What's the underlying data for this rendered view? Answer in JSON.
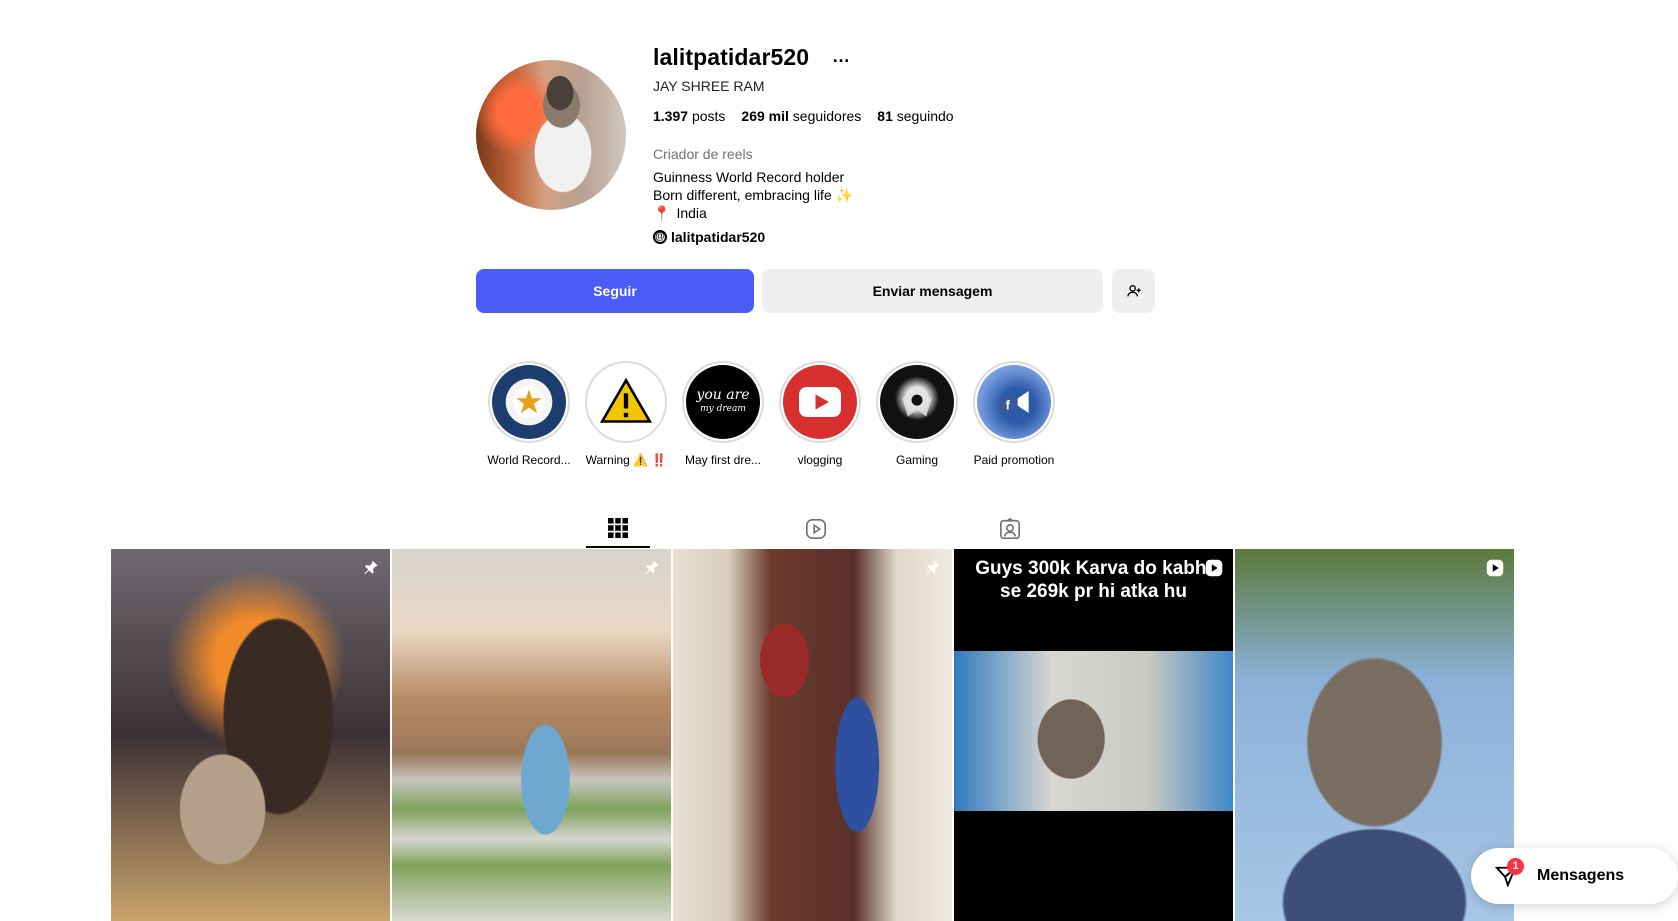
{
  "profile": {
    "username": "lalitpatidar520",
    "more_icon": "…",
    "full_name": "JAY SHREE RAM",
    "stats": {
      "posts_value": "1.397",
      "posts_label": "posts",
      "followers_value": "269 mil",
      "followers_label": "seguidores",
      "following_value": "81",
      "following_label": "seguindo"
    },
    "category": "Criador de reels",
    "bio_line1": "Guinness World Record holder",
    "bio_line2": "Born different, embracing life ✨",
    "bio_location_icon": "📍",
    "bio_location": "India",
    "threads_handle": "lalitpatidar520"
  },
  "actions": {
    "follow_label": "Seguir",
    "message_label": "Enviar mensagem",
    "add_user_icon": "person-add-icon"
  },
  "highlights": [
    {
      "label": "World Record..."
    },
    {
      "label": "Warning ⚠️ ‼️"
    },
    {
      "label": "May first dre...",
      "image_text_line1": "you are",
      "image_text_line2": "my dream"
    },
    {
      "label": "vlogging"
    },
    {
      "label": "Gaming"
    },
    {
      "label": "Paid promotion"
    }
  ],
  "tabs": [
    {
      "name": "posts",
      "icon": "grid-icon",
      "active": true
    },
    {
      "name": "reels",
      "icon": "reels-icon",
      "active": false
    },
    {
      "name": "tagged",
      "icon": "tagged-icon",
      "active": false
    }
  ],
  "posts": [
    {
      "badge": "pin-icon"
    },
    {
      "badge": "pin-icon"
    },
    {
      "badge": "pin-icon"
    },
    {
      "badge": "reel-icon",
      "caption": "Guys  300k Karva do kabhi se 269k pr hi atka hu"
    },
    {
      "badge": "reel-icon"
    }
  ],
  "messages_bar": {
    "label": "Mensagens",
    "unread_count": "1"
  },
  "colors": {
    "follow_button": "#4a5df9",
    "secondary_button": "#efeff1",
    "badge_red": "#ff3040"
  }
}
